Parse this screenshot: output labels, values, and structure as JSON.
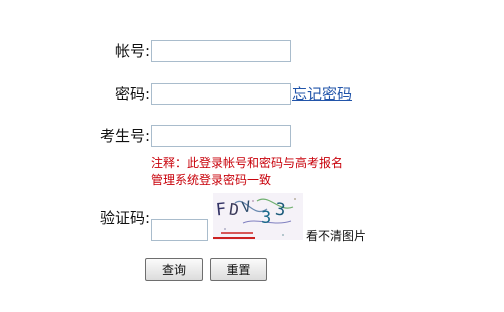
{
  "form": {
    "account_label": "帐号:",
    "password_label": "密码:",
    "forgot_password": "忘记密码",
    "exam_number_label": "考生号:",
    "note_line1": "注释：此登录帐号和密码与高考报名",
    "note_line2": "管理系统登录密码一致",
    "captcha_label": "验证码:",
    "captcha_characters": "FDV33",
    "captcha_refresh": "看不清图片",
    "query_button": "查询",
    "reset_button": "重置"
  },
  "colors": {
    "note": "#c8000a",
    "link": "#2255aa",
    "input_border": "#a9bccc"
  }
}
